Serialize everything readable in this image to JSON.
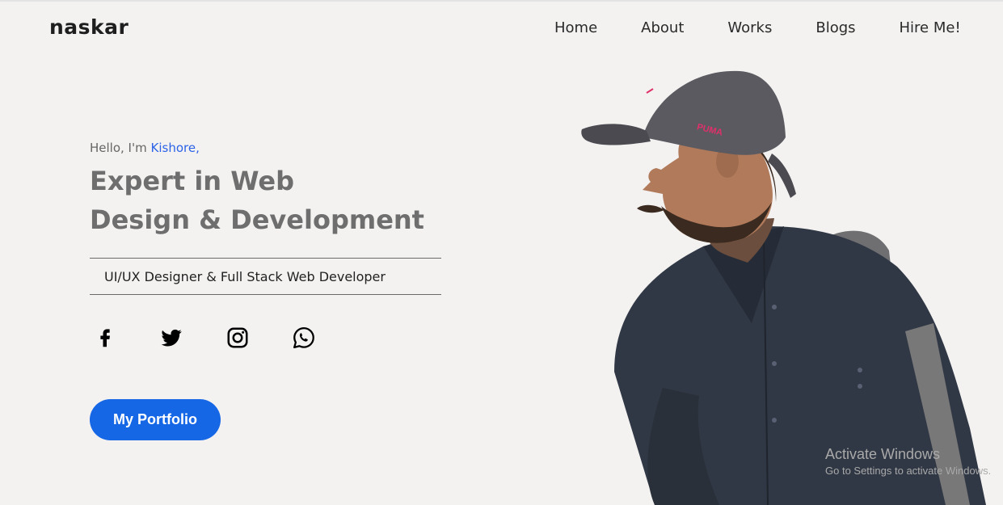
{
  "brand": "naskar",
  "nav": {
    "home": "Home",
    "about": "About",
    "works": "Works",
    "blogs": "Blogs",
    "hire": "Hire Me!"
  },
  "intro": {
    "hello_prefix": "Hello, I'm",
    "name": "Kishore,",
    "headline_line1": "Expert in Web",
    "headline_line2": "Design & Development",
    "subtitle": "UI/UX Designer & Full Stack Web Developer"
  },
  "socials": [
    {
      "icon": "facebook-icon"
    },
    {
      "icon": "twitter-icon"
    },
    {
      "icon": "instagram-icon"
    },
    {
      "icon": "whatsapp-icon"
    }
  ],
  "cta": {
    "label": "My Portfolio"
  },
  "hero": {
    "cap_text": "PUMA"
  },
  "watermark": {
    "title": "Activate Windows",
    "subtitle": "Go to Settings to activate Windows."
  },
  "colors": {
    "background": "#f3f2f1",
    "accent_blue": "#1667e6",
    "name_blue": "#2c63e6",
    "headline_gray": "#6e6e6e"
  }
}
